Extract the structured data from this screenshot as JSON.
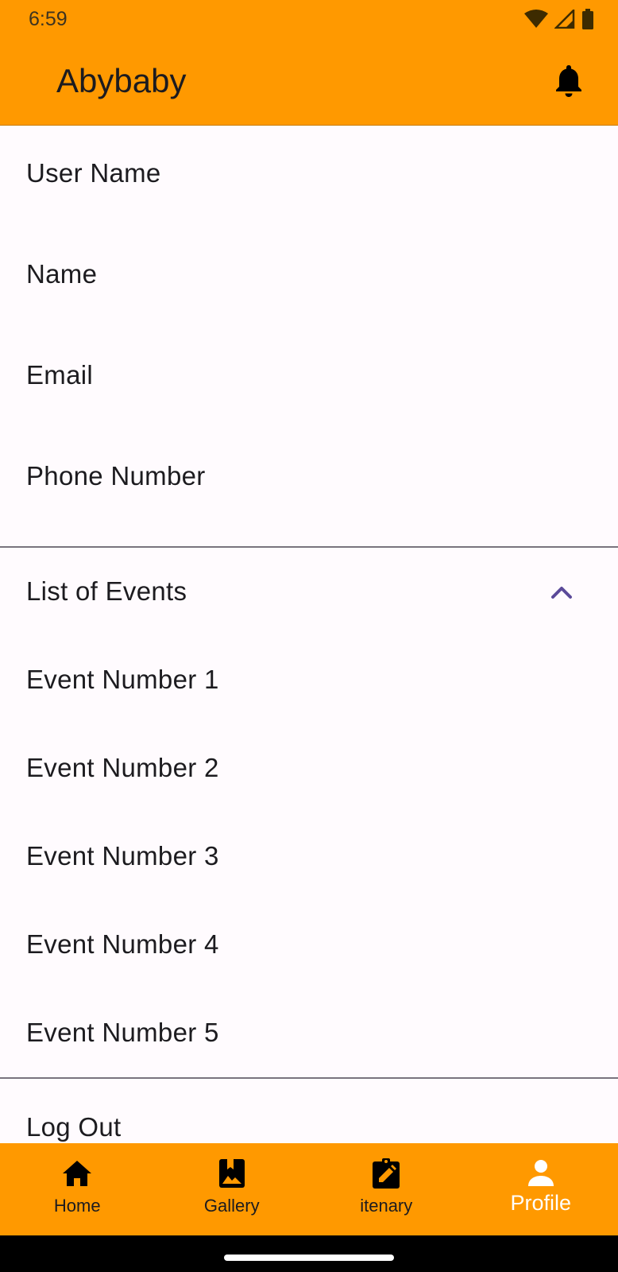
{
  "status_bar": {
    "time": "6:59",
    "icons": [
      "wifi-icon",
      "signal-icon",
      "battery-icon"
    ]
  },
  "app_bar": {
    "title": "Abybaby",
    "notification_icon": "bell-icon"
  },
  "profile_fields": [
    {
      "label": "User Name"
    },
    {
      "label": "Name"
    },
    {
      "label": "Email"
    },
    {
      "label": "Phone Number"
    }
  ],
  "events": {
    "header": "List of Events",
    "expanded": true,
    "items": [
      {
        "label": "Event Number 1"
      },
      {
        "label": "Event Number 2"
      },
      {
        "label": "Event Number 3"
      },
      {
        "label": "Event Number 4"
      },
      {
        "label": "Event Number 5"
      }
    ]
  },
  "logout_label": "Log Out",
  "bottom_nav": {
    "items": [
      {
        "label": "Home",
        "icon": "home-icon",
        "active": false
      },
      {
        "label": "Gallery",
        "icon": "gallery-icon",
        "active": false
      },
      {
        "label": "itenary",
        "icon": "edit-clipboard-icon",
        "active": false
      },
      {
        "label": "Profile",
        "icon": "person-icon",
        "active": true
      }
    ]
  },
  "colors": {
    "primary": "#ff9900",
    "background": "#fffbfe",
    "accent": "#5b4a99",
    "divider": "#79747e"
  }
}
